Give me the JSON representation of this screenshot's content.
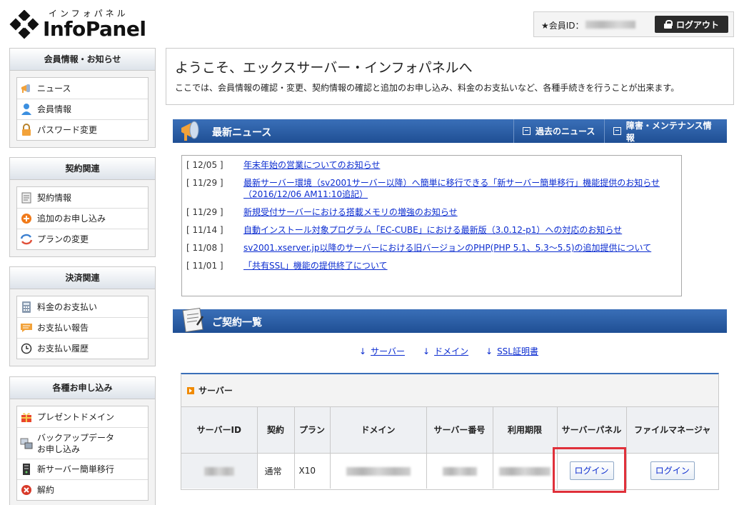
{
  "header": {
    "logo_kana": "インフォパネル",
    "logo_text": "InfoPanel",
    "member_label": "★会員ID：",
    "logout_label": "ログアウト"
  },
  "sidebar": [
    {
      "title": "会員情報・お知らせ",
      "items": [
        {
          "label": "ニュース",
          "icon": "megaphone-icon"
        },
        {
          "label": "会員情報",
          "icon": "user-icon"
        },
        {
          "label": "パスワード変更",
          "icon": "lock-icon"
        }
      ]
    },
    {
      "title": "契約関連",
      "items": [
        {
          "label": "契約情報",
          "icon": "document-icon"
        },
        {
          "label": "追加のお申し込み",
          "icon": "plus-icon"
        },
        {
          "label": "プランの変更",
          "icon": "refresh-icon"
        }
      ]
    },
    {
      "title": "決済関連",
      "items": [
        {
          "label": "料金のお支払い",
          "icon": "calculator-icon"
        },
        {
          "label": "お支払い報告",
          "icon": "chat-icon"
        },
        {
          "label": "お支払い履歴",
          "icon": "clock-icon"
        }
      ]
    },
    {
      "title": "各種お申し込み",
      "items": [
        {
          "label": "プレゼントドメイン",
          "icon": "gift-icon"
        },
        {
          "label": "バックアップデータ\nお申し込み",
          "icon": "backup-icon"
        },
        {
          "label": "新サーバー簡単移行",
          "icon": "server-icon"
        },
        {
          "label": "解約",
          "icon": "cancel-icon"
        }
      ]
    }
  ],
  "welcome": {
    "title": "ようこそ、エックスサーバー・インフォパネルへ",
    "description": "ここでは、会員情報の確認・変更、契約情報の確認と追加のお申し込み、料金のお支払いなど、各種手続きを行うことが出来ます。"
  },
  "news_section": {
    "title": "最新ニュース",
    "past_news_label": "過去のニュース",
    "maintenance_label": "障害・メンテナンス情報",
    "items": [
      {
        "date": "[ 12/05 ]",
        "text": "年末年始の営業についてのお知らせ"
      },
      {
        "date": "[ 11/29 ]",
        "text": "最新サーバー環境（sv2001サーバー以降）へ簡単に移行できる「新サーバー簡単移行」機能提供のお知らせ\n（2016/12/06 AM11:10追記）"
      },
      {
        "date": "[ 11/29 ]",
        "text": "新規受付サーバーにおける搭載メモリの増強のお知らせ"
      },
      {
        "date": "[ 11/14 ]",
        "text": "自動インストール対象プログラム「EC-CUBE」における最新版（3.0.12-p1）への対応のお知らせ"
      },
      {
        "date": "[ 11/08 ]",
        "text": "sv2001.xserver.jp以降のサーバーにおける旧バージョンのPHP(PHP 5.1、5.3～5.5)の追加提供について"
      },
      {
        "date": "[ 11/01 ]",
        "text": "「共有SSL」機能の提供終了について"
      }
    ]
  },
  "contract_section": {
    "title": "ご契約一覧",
    "anchors": [
      "サーバー",
      "ドメイン",
      "SSL証明書"
    ]
  },
  "server_table": {
    "heading": "サーバー",
    "columns": [
      "サーバーID",
      "契約",
      "プラン",
      "ドメイン",
      "サーバー番号",
      "利用期限",
      "サーバーパネル",
      "ファイルマネージャ"
    ],
    "row": {
      "contract": "通常",
      "plan": "X10",
      "server_panel_btn": "ログイン",
      "file_manager_btn": "ログイン"
    }
  },
  "colors": {
    "accent_blue": "#1f4f94",
    "link": "#0b2cd0",
    "highlight": "#e0303a",
    "logout_bg": "#2b2b2b"
  }
}
